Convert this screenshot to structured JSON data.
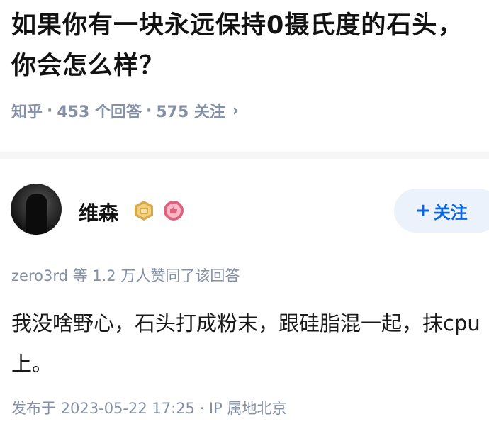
{
  "question": {
    "title": "如果你有一块永远保持0摄氏度的石头，你会怎么样？",
    "source": "知乎",
    "separator": "·",
    "answer_count": "453 个回答",
    "follow_count": "575 关注",
    "chevron": "›"
  },
  "author": {
    "name": "维森",
    "badges": [
      "gold-badge-icon",
      "pink-badge-icon"
    ],
    "follow_plus": "+",
    "follow_label": "关注"
  },
  "colors": {
    "accent": "#0a66e8",
    "follow_bg": "#ebf2fb",
    "meta_text": "#8590a6",
    "gold_badge": "#d8a94a",
    "pink_badge": "#e0607e"
  },
  "answer": {
    "upvote_line": "zero3rd 等 1.2 万人赞同了该回答",
    "content": "我没啥野心，石头打成粉末，跟硅脂混一起，抹cpu上。",
    "published": "发布于 2023-05-22 17:25 · IP 属地北京"
  }
}
